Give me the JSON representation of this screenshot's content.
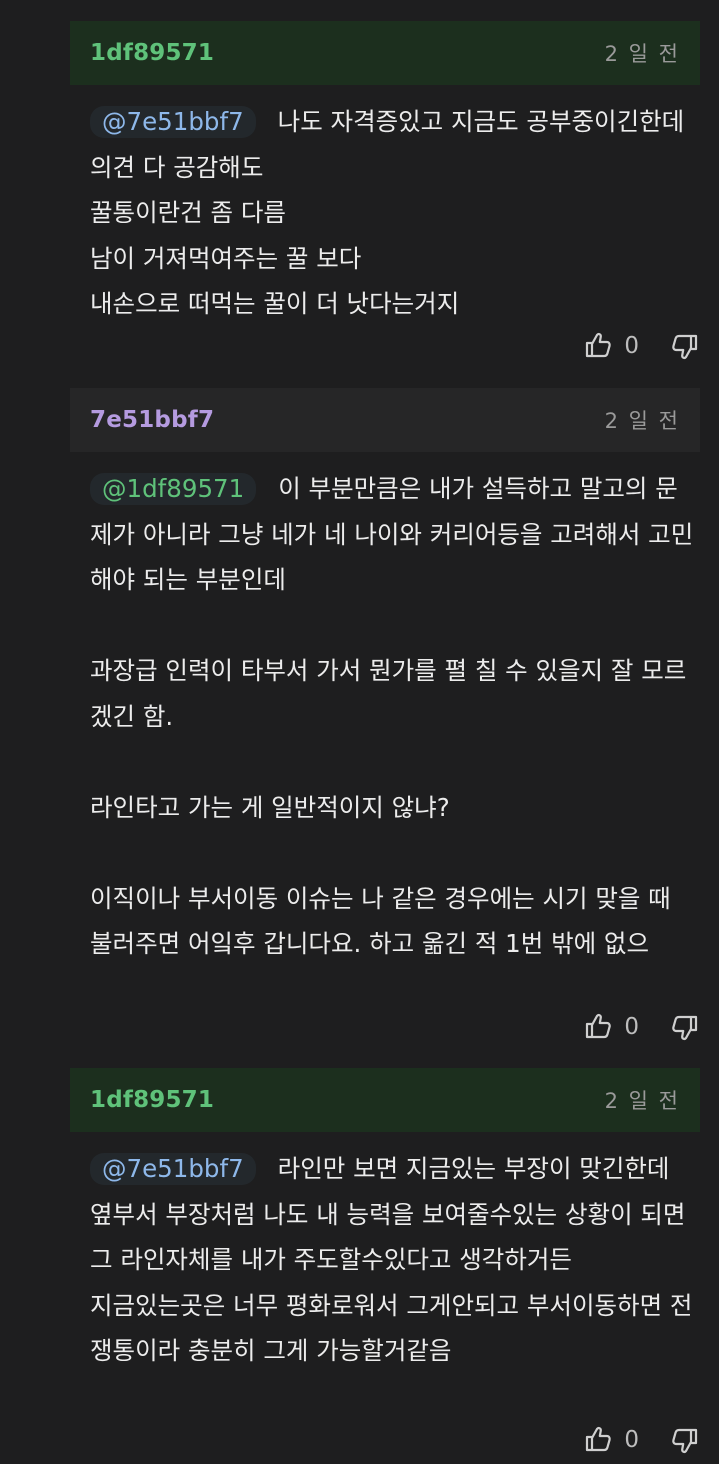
{
  "comments": [
    {
      "author": "1df89571",
      "time": "2 일 전",
      "mention": "@7e51bbf7",
      "text": "나도 자격증있고 지금도 공부중이긴한데의견 다 공감해도\n꿀통이란건 좀 다름\n남이 거져먹여주는 꿀 보다\n내손으로 떠먹는 꿀이 더 낫다는거지",
      "likes": "0"
    },
    {
      "author": "7e51bbf7",
      "time": "2 일 전",
      "mention": "@1df89571",
      "text": "이 부분만큼은 내가 설득하고 말고의 문제가 아니라 그냥 네가 네 나이와 커리어등을 고려해서 고민해야 되는 부분인데\n\n과장급 인력이 타부서 가서 뭔가를 펼 칠 수 있을지 잘 모르겠긴 함.\n\n라인타고 가는 게 일반적이지 않냐?\n\n이직이나 부서이동 이슈는 나 같은 경우에는 시기 맞을 때 불러주면 어잌후 갑니다요. 하고 옮긴 적 1번 밖에 없으",
      "likes": "0"
    },
    {
      "author": "1df89571",
      "time": "2 일 전",
      "mention": "@7e51bbf7",
      "text": "라인만 보면 지금있는 부장이 맞긴한데\n옆부서 부장처럼 나도 내 능력을 보여줄수있는 상황이 되면 그 라인자체를 내가 주도할수있다고 생각하거든\n지금있는곳은 너무 평화로워서 그게안되고 부서이동하면 전쟁통이라 충분히 그게 가능할거같음",
      "likes": "0"
    }
  ],
  "colors": {
    "background": "#1e1e1f",
    "header_green": "#1c2f1e",
    "header_gray": "#262627",
    "author_green": "#5fc27a",
    "author_purple": "#b59be0",
    "mention_blue": "#8eb8ea"
  },
  "icons": [
    "thumbs-up-icon",
    "thumbs-down-icon"
  ]
}
